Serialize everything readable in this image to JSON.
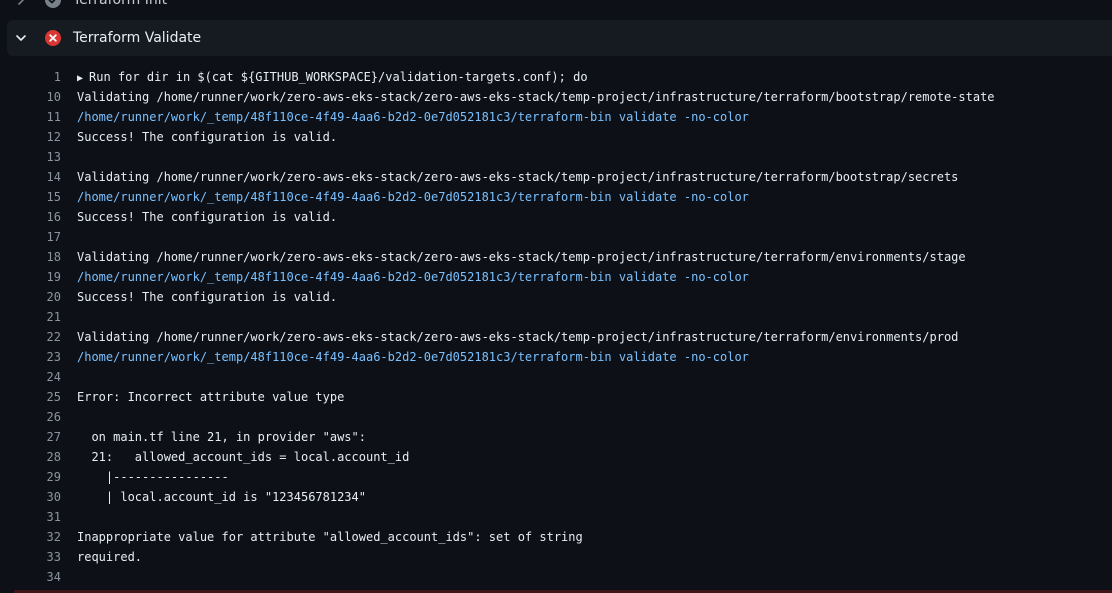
{
  "steps": {
    "previous": {
      "name": "Terraform Init",
      "status": "success"
    },
    "current": {
      "name": "Terraform Validate",
      "status": "failure"
    }
  },
  "colors": {
    "failure": "#da3633",
    "command": "#79c0ff",
    "line_number": "#8b949e"
  },
  "log": [
    {
      "n": "1",
      "text": "Run for dir in $(cat ${GITHUB_WORKSPACE}/validation-targets.conf); do",
      "kind": "group"
    },
    {
      "n": "10",
      "text": "Validating /home/runner/work/zero-aws-eks-stack/zero-aws-eks-stack/temp-project/infrastructure/terraform/bootstrap/remote-state",
      "kind": "plain"
    },
    {
      "n": "11",
      "text": "/home/runner/work/_temp/48f110ce-4f49-4aa6-b2d2-0e7d052181c3/terraform-bin validate -no-color",
      "kind": "cmd"
    },
    {
      "n": "12",
      "text": "Success! The configuration is valid.",
      "kind": "plain"
    },
    {
      "n": "13",
      "text": "",
      "kind": "plain"
    },
    {
      "n": "14",
      "text": "Validating /home/runner/work/zero-aws-eks-stack/zero-aws-eks-stack/temp-project/infrastructure/terraform/bootstrap/secrets",
      "kind": "plain"
    },
    {
      "n": "15",
      "text": "/home/runner/work/_temp/48f110ce-4f49-4aa6-b2d2-0e7d052181c3/terraform-bin validate -no-color",
      "kind": "cmd"
    },
    {
      "n": "16",
      "text": "Success! The configuration is valid.",
      "kind": "plain"
    },
    {
      "n": "17",
      "text": "",
      "kind": "plain"
    },
    {
      "n": "18",
      "text": "Validating /home/runner/work/zero-aws-eks-stack/zero-aws-eks-stack/temp-project/infrastructure/terraform/environments/stage",
      "kind": "plain"
    },
    {
      "n": "19",
      "text": "/home/runner/work/_temp/48f110ce-4f49-4aa6-b2d2-0e7d052181c3/terraform-bin validate -no-color",
      "kind": "cmd"
    },
    {
      "n": "20",
      "text": "Success! The configuration is valid.",
      "kind": "plain"
    },
    {
      "n": "21",
      "text": "",
      "kind": "plain"
    },
    {
      "n": "22",
      "text": "Validating /home/runner/work/zero-aws-eks-stack/zero-aws-eks-stack/temp-project/infrastructure/terraform/environments/prod",
      "kind": "plain"
    },
    {
      "n": "23",
      "text": "/home/runner/work/_temp/48f110ce-4f49-4aa6-b2d2-0e7d052181c3/terraform-bin validate -no-color",
      "kind": "cmd"
    },
    {
      "n": "24",
      "text": "",
      "kind": "plain"
    },
    {
      "n": "25",
      "text": "Error: Incorrect attribute value type",
      "kind": "plain"
    },
    {
      "n": "26",
      "text": "",
      "kind": "plain"
    },
    {
      "n": "27",
      "text": "  on main.tf line 21, in provider \"aws\":",
      "kind": "plain"
    },
    {
      "n": "28",
      "text": "  21:   allowed_account_ids = local.account_id",
      "kind": "plain"
    },
    {
      "n": "29",
      "text": "    |----------------",
      "kind": "plain"
    },
    {
      "n": "30",
      "text": "    | local.account_id is \"123456781234\"",
      "kind": "plain"
    },
    {
      "n": "31",
      "text": "",
      "kind": "plain"
    },
    {
      "n": "32",
      "text": "Inappropriate value for attribute \"allowed_account_ids\": set of string",
      "kind": "plain"
    },
    {
      "n": "33",
      "text": "required.",
      "kind": "plain"
    },
    {
      "n": "34",
      "text": "",
      "kind": "plain"
    }
  ]
}
